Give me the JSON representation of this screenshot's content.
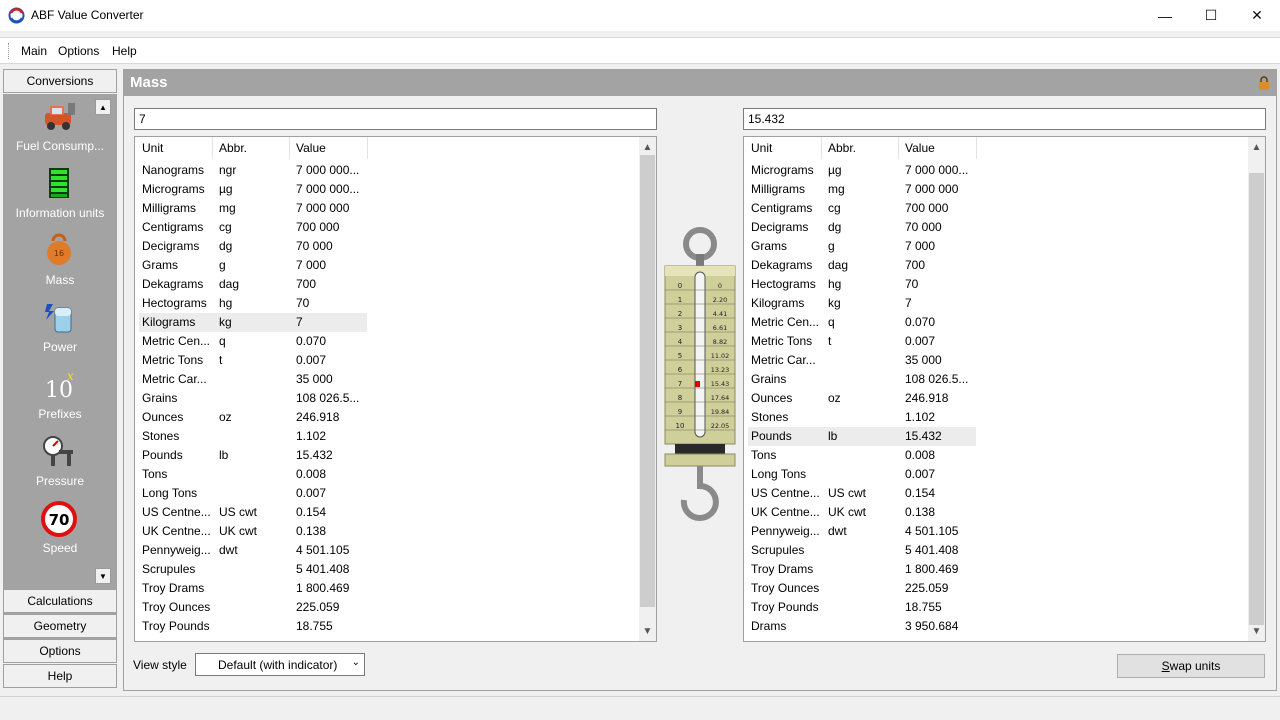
{
  "window": {
    "title": "ABF Value Converter",
    "controls": {
      "minimize": "—",
      "maximize": "☐",
      "close": "✕"
    }
  },
  "menu": [
    "Main",
    "Options",
    "Help"
  ],
  "nav": {
    "header": "Conversions",
    "items": [
      {
        "label": "Fuel Consump...",
        "icon": "car-icon"
      },
      {
        "label": "Information units",
        "icon": "memory-chip-icon"
      },
      {
        "label": "Mass",
        "icon": "weight-icon"
      },
      {
        "label": "Power",
        "icon": "battery-icon"
      },
      {
        "label": "Prefixes",
        "icon": "power-of-ten-icon"
      },
      {
        "label": "Pressure",
        "icon": "gauge-icon"
      },
      {
        "label": "Speed",
        "icon": "speed-limit-icon",
        "sign": "70"
      }
    ],
    "bottom_buttons": [
      "Calculations",
      "Geometry",
      "Options",
      "Help"
    ]
  },
  "panel": {
    "title": "Mass",
    "columns": [
      "Unit",
      "Abbr.",
      "Value"
    ],
    "left": {
      "input_value": "7",
      "selected_index": 8,
      "rows": [
        [
          "Nanograms",
          "ngr",
          "7 000 000..."
        ],
        [
          "Micrograms",
          "µg",
          "7 000 000..."
        ],
        [
          "Milligrams",
          "mg",
          "7 000 000"
        ],
        [
          "Centigrams",
          "cg",
          "700 000"
        ],
        [
          "Decigrams",
          "dg",
          "70 000"
        ],
        [
          "Grams",
          "g",
          "7 000"
        ],
        [
          "Dekagrams",
          "dag",
          "700"
        ],
        [
          "Hectograms",
          "hg",
          "70"
        ],
        [
          "Kilograms",
          "kg",
          "7"
        ],
        [
          "Metric Cen...",
          "q",
          "0.070"
        ],
        [
          "Metric Tons",
          "t",
          "0.007"
        ],
        [
          "Metric Car...",
          "",
          "35 000"
        ],
        [
          "Grains",
          "",
          "108 026.5..."
        ],
        [
          "Ounces",
          "oz",
          "246.918"
        ],
        [
          "Stones",
          "",
          "1.102"
        ],
        [
          "Pounds",
          "lb",
          "15.432"
        ],
        [
          "Tons",
          "",
          "0.008"
        ],
        [
          "Long Tons",
          "",
          "0.007"
        ],
        [
          "US Centne...",
          "US cwt",
          "0.154"
        ],
        [
          "UK Centne...",
          "UK cwt",
          "0.138"
        ],
        [
          "Pennyweig...",
          "dwt",
          "4 501.105"
        ],
        [
          "Scrupules",
          "",
          "5 401.408"
        ],
        [
          "Troy Drams",
          "",
          "1 800.469"
        ],
        [
          "Troy Ounces",
          "",
          "225.059"
        ],
        [
          "Troy Pounds",
          "",
          "18.755"
        ]
      ]
    },
    "right": {
      "input_value": "15.432",
      "selected_index": 14,
      "rows": [
        [
          "Micrograms",
          "µg",
          "7 000 000..."
        ],
        [
          "Milligrams",
          "mg",
          "7 000 000"
        ],
        [
          "Centigrams",
          "cg",
          "700 000"
        ],
        [
          "Decigrams",
          "dg",
          "70 000"
        ],
        [
          "Grams",
          "g",
          "7 000"
        ],
        [
          "Dekagrams",
          "dag",
          "700"
        ],
        [
          "Hectograms",
          "hg",
          "70"
        ],
        [
          "Kilograms",
          "kg",
          "7"
        ],
        [
          "Metric Cen...",
          "q",
          "0.070"
        ],
        [
          "Metric Tons",
          "t",
          "0.007"
        ],
        [
          "Metric Car...",
          "",
          "35 000"
        ],
        [
          "Grains",
          "",
          "108 026.5..."
        ],
        [
          "Ounces",
          "oz",
          "246.918"
        ],
        [
          "Stones",
          "",
          "1.102"
        ],
        [
          "Pounds",
          "lb",
          "15.432"
        ],
        [
          "Tons",
          "",
          "0.008"
        ],
        [
          "Long Tons",
          "",
          "0.007"
        ],
        [
          "US Centne...",
          "US cwt",
          "0.154"
        ],
        [
          "UK Centne...",
          "UK cwt",
          "0.138"
        ],
        [
          "Pennyweig...",
          "dwt",
          "4 501.105"
        ],
        [
          "Scrupules",
          "",
          "5 401.408"
        ],
        [
          "Troy Drams",
          "",
          "1 800.469"
        ],
        [
          "Troy Ounces",
          "",
          "225.059"
        ],
        [
          "Troy Pounds",
          "",
          "18.755"
        ],
        [
          "Drams",
          "",
          "3 950.684"
        ]
      ]
    },
    "scale": {
      "left_ticks": [
        "0",
        "1",
        "2",
        "3",
        "4",
        "5",
        "6",
        "7",
        "8",
        "9",
        "10"
      ],
      "right_ticks": [
        "0",
        "2.20",
        "4.41",
        "6.61",
        "8.82",
        "11.02",
        "13.23",
        "15.43",
        "17.64",
        "19.84",
        "22.05"
      ],
      "indicator_value": 7,
      "indicator_color": "#e00000"
    },
    "view_style_label": "View style",
    "view_style_value": "Default (with indicator)",
    "swap_button": {
      "accel": "S",
      "rest": "wap units"
    }
  },
  "colors": {
    "nav_background": "#a3a3a3",
    "panel_header": "#a3a3a3",
    "selected_row": "#ececec"
  }
}
